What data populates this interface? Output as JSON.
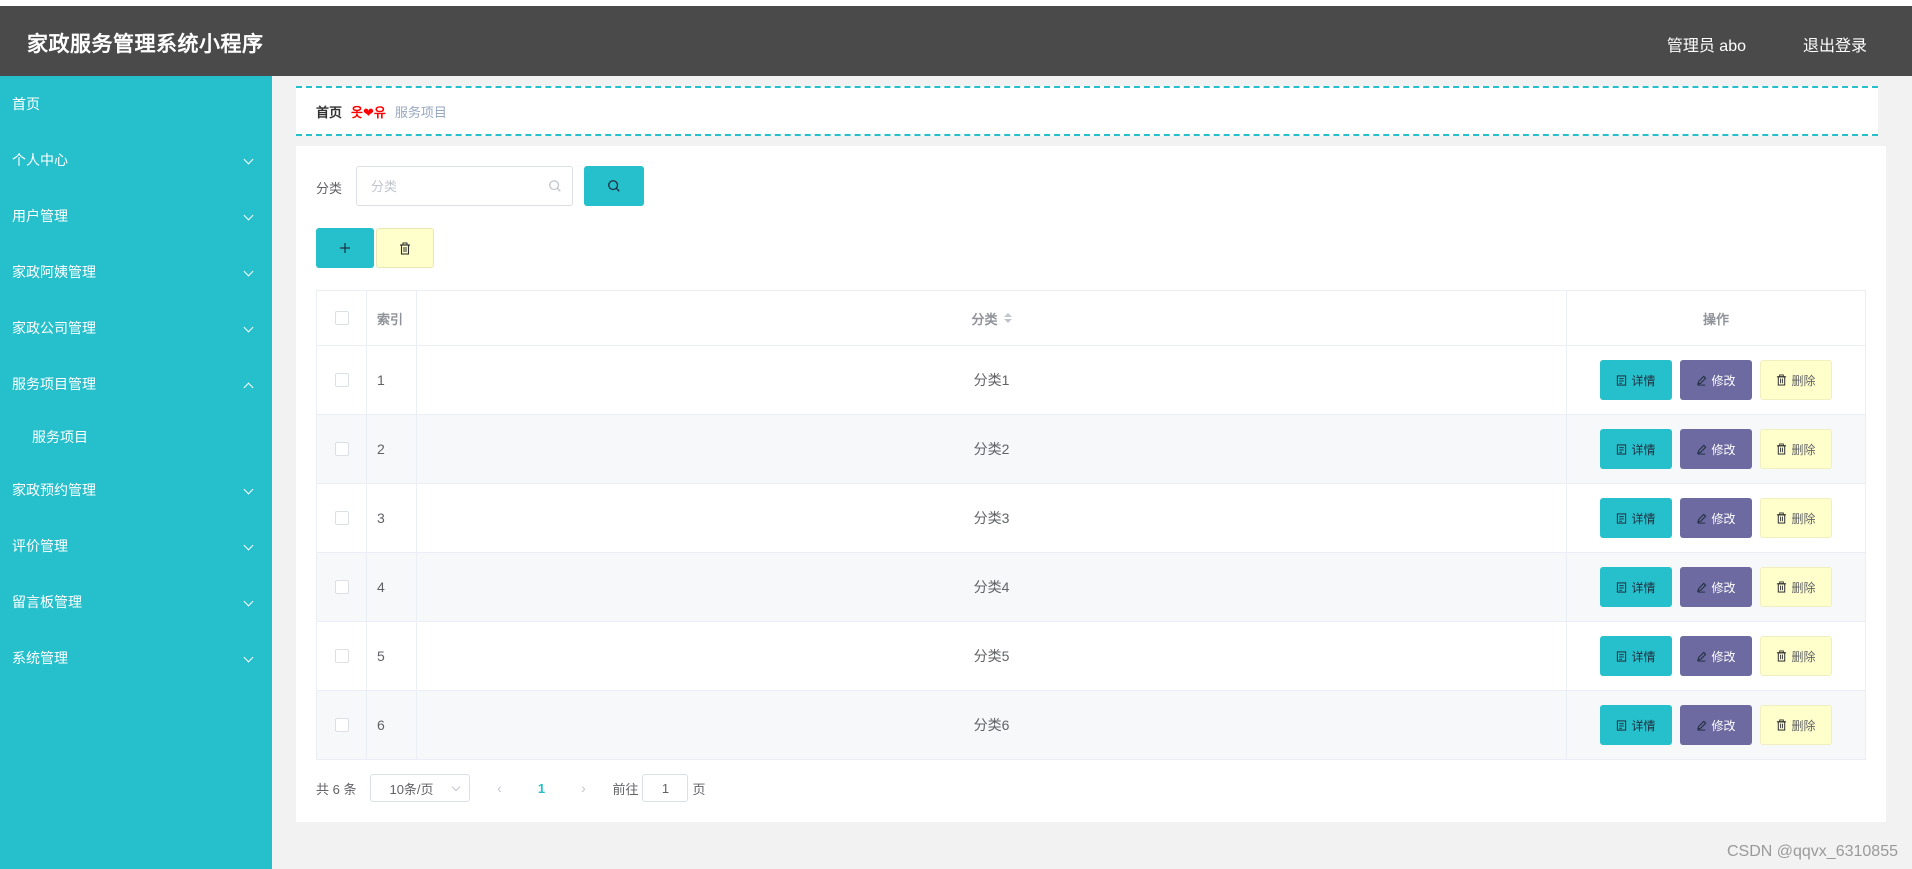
{
  "app": {
    "title": "家政服务管理系统小程序"
  },
  "header": {
    "user": "管理员 abo",
    "logout": "退出登录"
  },
  "sidebar": {
    "items": [
      {
        "label": "首页",
        "chevron": "none"
      },
      {
        "label": "个人中心",
        "chevron": "down"
      },
      {
        "label": "用户管理",
        "chevron": "down"
      },
      {
        "label": "家政阿姨管理",
        "chevron": "down"
      },
      {
        "label": "家政公司管理",
        "chevron": "down"
      },
      {
        "label": "服务项目管理",
        "chevron": "up"
      },
      {
        "label": "服务项目",
        "chevron": "none",
        "sub": true
      },
      {
        "label": "家政预约管理",
        "chevron": "down"
      },
      {
        "label": "评价管理",
        "chevron": "down"
      },
      {
        "label": "留言板管理",
        "chevron": "down"
      },
      {
        "label": "系统管理",
        "chevron": "down"
      }
    ]
  },
  "breadcrumb": {
    "home": "首页",
    "separator": "옷❤유",
    "current": "服务项目"
  },
  "filter": {
    "label": "分类",
    "placeholder": "分类"
  },
  "table": {
    "headers": {
      "index": "索引",
      "category": "分类",
      "actions": "操作"
    },
    "rows": [
      {
        "index": "1",
        "category": "分类1"
      },
      {
        "index": "2",
        "category": "分类2"
      },
      {
        "index": "3",
        "category": "分类3"
      },
      {
        "index": "4",
        "category": "分类4"
      },
      {
        "index": "5",
        "category": "分类5"
      },
      {
        "index": "6",
        "category": "分类6"
      }
    ],
    "actions": {
      "detail": "详情",
      "edit": "修改",
      "delete": "删除"
    }
  },
  "pagination": {
    "total": "共 6 条",
    "page_size": "10条/页",
    "current_page": "1",
    "goto_label": "前往",
    "goto_value": "1",
    "page_unit": "页"
  },
  "watermark": "CSDN @qqvx_6310855",
  "colors": {
    "accent": "#26c0cc",
    "header": "#4a4a4a",
    "edit": "#6c6aa0",
    "delete": "#ffffcc"
  }
}
